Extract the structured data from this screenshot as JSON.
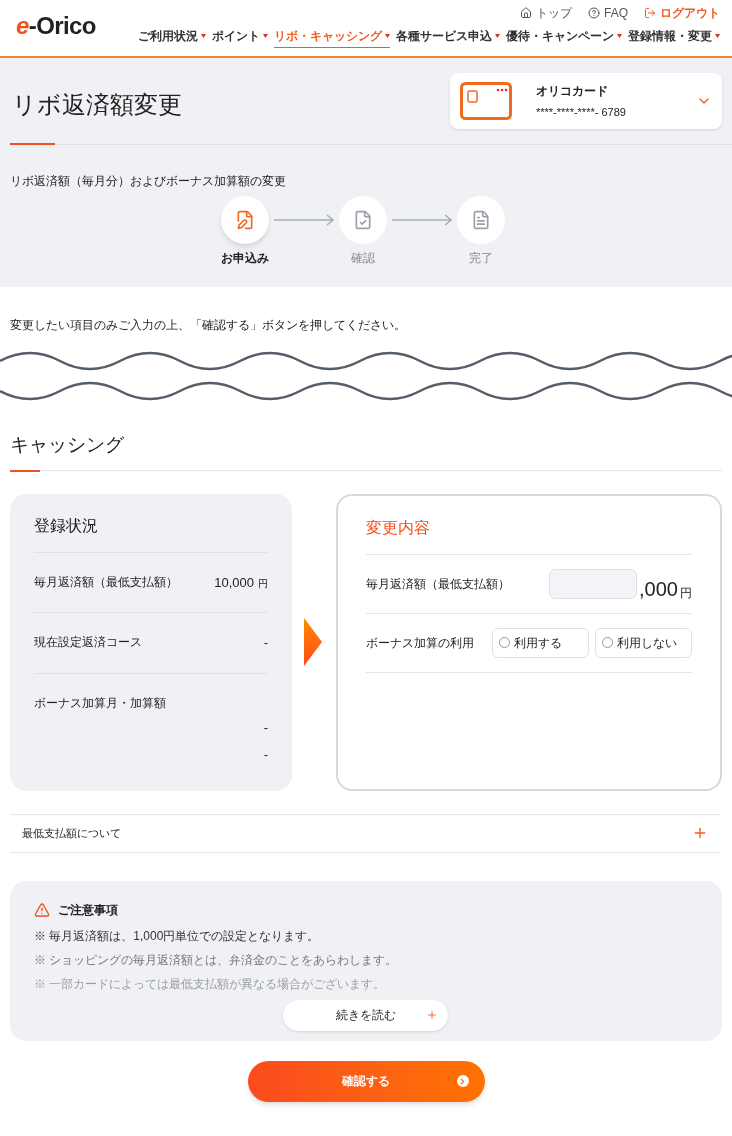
{
  "header": {
    "logo": {
      "mark": "e",
      "name": "-Orico"
    },
    "utility_links": [
      {
        "kind": "home",
        "label": "トップ"
      },
      {
        "kind": "help",
        "label": "FAQ"
      },
      {
        "kind": "logout",
        "label": "ログアウト"
      }
    ],
    "nav": [
      {
        "label": "ご利用状況",
        "selected": false
      },
      {
        "label": "ポイント",
        "selected": false
      },
      {
        "label": "リボ・キャッシング",
        "selected": true
      },
      {
        "label": "各種サービス申込",
        "selected": false
      },
      {
        "label": "優待・キャンペーン",
        "selected": false
      },
      {
        "label": "登録情報・変更",
        "selected": false
      }
    ]
  },
  "page_title": "リボ返済額変更",
  "card": {
    "name": "オリコカード",
    "number": "****-****-****- 6789"
  },
  "subtitle": "リボ返済額（毎月分）およびボーナス加算額の変更",
  "steps": [
    {
      "kind": "apply",
      "label": "お申込み",
      "selected": true
    },
    {
      "kind": "confirm",
      "label": "確認",
      "selected": false
    },
    {
      "kind": "done",
      "label": "完了",
      "selected": false
    }
  ],
  "instruction": "変更したい項目のみご入力の上、「確認する」ボタンを押してください。",
  "section_title": "キャッシング",
  "current": {
    "title": "登録状況",
    "rows": [
      {
        "label": "毎月返済額（最低支払額）",
        "values": [
          "10,000"
        ],
        "unit": "円"
      },
      {
        "label": "現在設定返済コース",
        "values": [
          "-"
        ]
      },
      {
        "label": "ボーナス加算月・加算額",
        "values": [
          "-",
          "-"
        ]
      }
    ]
  },
  "change": {
    "title": "変更内容",
    "rows": [
      {
        "kind": "amount",
        "label": "毎月返済額（最低支払額）",
        "suffix": ",000",
        "unit": "円"
      },
      {
        "kind": "radio",
        "label": "ボーナス加算の利用",
        "options": [
          {
            "label": "利用する",
            "selected": false
          },
          {
            "label": "利用しない",
            "selected": false
          }
        ]
      }
    ]
  },
  "accordion": {
    "label": "最低支払額について",
    "expanded": false
  },
  "notice": {
    "title": "ご注意事項",
    "items": [
      "※ 毎月返済額は、1,000円単位での設定となります。",
      "※ ショッピングの毎月返済額とは、弁済金のことをあらわします。",
      "※ 一部カードによっては最低支払額が異なる場合がございます。"
    ],
    "more_button": "続きを読む"
  },
  "submit": "確認する"
}
